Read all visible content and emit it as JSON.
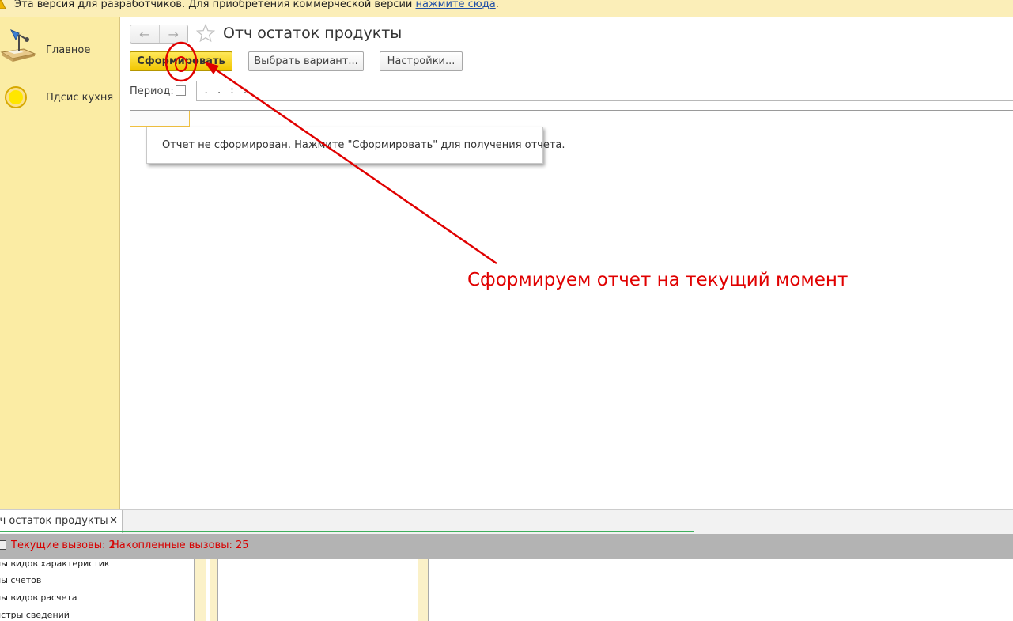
{
  "topbar": {
    "message": "Эта версия для разработчиков. Для приобретения коммерческой версии ",
    "link": "нажмите сюда",
    "suffix": "."
  },
  "sidebar": {
    "items": [
      {
        "label": "Главное",
        "icon": "desk-lamp-icon"
      },
      {
        "label": "Пдсис кухня",
        "icon": "circle-icon"
      }
    ]
  },
  "form": {
    "title": "Отч остаток продукты",
    "back_icon": "arrow-left-icon",
    "forward_icon": "arrow-right-icon",
    "favorite_icon": "star-icon",
    "generate_label": "Сформировать",
    "variant_label": "Выбрать вариант...",
    "settings_label": "Настройки...",
    "period_label": "Период:",
    "period_value": ". .   : :"
  },
  "report": {
    "notice": "Отчет не сформирован. Нажмите \"Сформировать\" для получения отчета."
  },
  "annotation": {
    "text": "Сформируем отчет на текущий момент",
    "color": "#e00000"
  },
  "tabs": [
    {
      "label": "тч остаток продукты",
      "close": "✕"
    }
  ],
  "status": {
    "current_calls": "Текущие вызовы: 2",
    "accumulated_calls": "Накопленные вызовы: 25",
    "color": "#d70000"
  },
  "bottom_list": [
    "ны видов характеристик",
    "ны счетов",
    "ны видов расчета",
    "истры сведений"
  ],
  "colors": {
    "sidebar_bg": "#fbeca4",
    "topbar_bg": "#fbeeb8",
    "primary_button": "#f1c600",
    "status_bg": "#b3b3b3"
  }
}
